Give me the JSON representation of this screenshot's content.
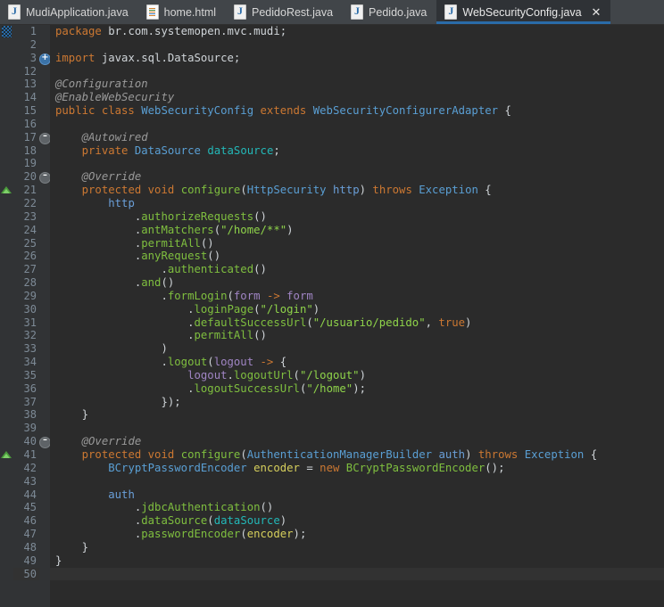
{
  "window": {
    "app": "Eclipse IDE - Java Editor",
    "background_color": "#2b2b2b",
    "accent_color": "#2a6ba8"
  },
  "tabbar": {
    "tabs": [
      {
        "label": "MudiApplication.java",
        "icon": "java-file-icon",
        "active": false,
        "closable": false
      },
      {
        "label": "home.html",
        "icon": "html-file-icon",
        "active": false,
        "closable": false
      },
      {
        "label": "PedidoRest.java",
        "icon": "java-file-icon",
        "active": false,
        "closable": false
      },
      {
        "label": "Pedido.java",
        "icon": "java-file-icon",
        "active": false,
        "closable": false
      },
      {
        "label": "WebSecurityConfig.java",
        "icon": "java-file-icon",
        "active": true,
        "closable": true,
        "close_label": "✕"
      }
    ]
  },
  "editor": {
    "file": "WebSecurityConfig.java",
    "language": "java",
    "current_line": 50,
    "line_numbers": [
      1,
      2,
      3,
      12,
      13,
      14,
      15,
      16,
      17,
      18,
      19,
      20,
      21,
      22,
      23,
      24,
      25,
      26,
      27,
      28,
      29,
      30,
      31,
      32,
      33,
      34,
      35,
      36,
      37,
      38,
      39,
      40,
      41,
      42,
      43,
      44,
      45,
      46,
      47,
      48,
      49,
      50
    ],
    "markers": {
      "change_bar_lines": [
        1
      ],
      "override_triangle_lines": [
        21,
        41
      ],
      "fold_expand_lines": [
        3
      ],
      "fold_collapse_lines": [
        17,
        20,
        40
      ]
    },
    "lines": [
      {
        "n": 1,
        "tokens": [
          [
            "kw",
            "package"
          ],
          [
            "plain",
            " br.com.systemopen.mvc.mudi;"
          ]
        ]
      },
      {
        "n": 2,
        "tokens": []
      },
      {
        "n": 3,
        "tokens": [
          [
            "kw",
            "import"
          ],
          [
            "plain",
            " javax.sql.DataSource;"
          ]
        ]
      },
      {
        "n": 12,
        "tokens": []
      },
      {
        "n": 13,
        "tokens": [
          [
            "ann",
            "@Configuration"
          ]
        ]
      },
      {
        "n": 14,
        "tokens": [
          [
            "ann",
            "@EnableWebSecurity"
          ]
        ]
      },
      {
        "n": 15,
        "tokens": [
          [
            "kw",
            "public class "
          ],
          [
            "type",
            "WebSecurityConfig"
          ],
          [
            "kw",
            " extends "
          ],
          [
            "type",
            "WebSecurityConfigurerAdapter"
          ],
          [
            "punct",
            " {"
          ]
        ]
      },
      {
        "n": 16,
        "tokens": []
      },
      {
        "n": 17,
        "tokens": [
          [
            "plain",
            "    "
          ],
          [
            "ann",
            "@Autowired"
          ]
        ]
      },
      {
        "n": 18,
        "tokens": [
          [
            "plain",
            "    "
          ],
          [
            "kw",
            "private "
          ],
          [
            "type",
            "DataSource"
          ],
          [
            "plain",
            " "
          ],
          [
            "fld",
            "dataSource"
          ],
          [
            "punct",
            ";"
          ]
        ]
      },
      {
        "n": 19,
        "tokens": []
      },
      {
        "n": 20,
        "tokens": [
          [
            "plain",
            "    "
          ],
          [
            "ann",
            "@Override"
          ]
        ]
      },
      {
        "n": 21,
        "tokens": [
          [
            "plain",
            "    "
          ],
          [
            "kw",
            "protected void "
          ],
          [
            "meth",
            "configure"
          ],
          [
            "punct",
            "("
          ],
          [
            "type",
            "HttpSecurity"
          ],
          [
            "plain",
            " "
          ],
          [
            "parm2",
            "http"
          ],
          [
            "punct",
            ") "
          ],
          [
            "kw",
            "throws "
          ],
          [
            "type",
            "Exception"
          ],
          [
            "punct",
            " {"
          ]
        ]
      },
      {
        "n": 22,
        "tokens": [
          [
            "plain",
            "        "
          ],
          [
            "parm2",
            "http"
          ]
        ]
      },
      {
        "n": 23,
        "tokens": [
          [
            "plain",
            "            ."
          ],
          [
            "meth",
            "authorizeRequests"
          ],
          [
            "punct",
            "()"
          ]
        ]
      },
      {
        "n": 24,
        "tokens": [
          [
            "plain",
            "            ."
          ],
          [
            "meth",
            "antMatchers"
          ],
          [
            "punct",
            "("
          ],
          [
            "str",
            "\"/home/**\""
          ],
          [
            "punct",
            ")"
          ]
        ]
      },
      {
        "n": 25,
        "tokens": [
          [
            "plain",
            "            ."
          ],
          [
            "meth",
            "permitAll"
          ],
          [
            "punct",
            "()"
          ]
        ]
      },
      {
        "n": 26,
        "tokens": [
          [
            "plain",
            "            ."
          ],
          [
            "meth",
            "anyRequest"
          ],
          [
            "punct",
            "()"
          ]
        ]
      },
      {
        "n": 27,
        "tokens": [
          [
            "plain",
            "                ."
          ],
          [
            "meth",
            "authenticated"
          ],
          [
            "punct",
            "()"
          ]
        ]
      },
      {
        "n": 28,
        "tokens": [
          [
            "plain",
            "            ."
          ],
          [
            "meth",
            "and"
          ],
          [
            "punct",
            "()"
          ]
        ]
      },
      {
        "n": 29,
        "tokens": [
          [
            "plain",
            "                ."
          ],
          [
            "meth",
            "formLogin"
          ],
          [
            "punct",
            "("
          ],
          [
            "param",
            "form"
          ],
          [
            "plain",
            " "
          ],
          [
            "kw",
            "-> "
          ],
          [
            "param",
            "form"
          ]
        ]
      },
      {
        "n": 30,
        "tokens": [
          [
            "plain",
            "                    ."
          ],
          [
            "meth",
            "loginPage"
          ],
          [
            "punct",
            "("
          ],
          [
            "str",
            "\"/login\""
          ],
          [
            "punct",
            ")"
          ]
        ]
      },
      {
        "n": 31,
        "tokens": [
          [
            "plain",
            "                    ."
          ],
          [
            "meth",
            "defaultSuccessUrl"
          ],
          [
            "punct",
            "("
          ],
          [
            "str",
            "\"/usuario/pedido\""
          ],
          [
            "punct",
            ", "
          ],
          [
            "kw",
            "true"
          ],
          [
            "punct",
            ")"
          ]
        ]
      },
      {
        "n": 32,
        "tokens": [
          [
            "plain",
            "                    ."
          ],
          [
            "meth",
            "permitAll"
          ],
          [
            "punct",
            "()"
          ]
        ]
      },
      {
        "n": 33,
        "tokens": [
          [
            "plain",
            "                )"
          ]
        ]
      },
      {
        "n": 34,
        "tokens": [
          [
            "plain",
            "                ."
          ],
          [
            "meth",
            "logout"
          ],
          [
            "punct",
            "("
          ],
          [
            "param",
            "logout"
          ],
          [
            "plain",
            " "
          ],
          [
            "kw",
            "-> "
          ],
          [
            "punct",
            "{"
          ]
        ]
      },
      {
        "n": 35,
        "tokens": [
          [
            "plain",
            "                    "
          ],
          [
            "param",
            "logout"
          ],
          [
            "punct",
            "."
          ],
          [
            "meth",
            "logoutUrl"
          ],
          [
            "punct",
            "("
          ],
          [
            "str",
            "\"/logout\""
          ],
          [
            "punct",
            ")"
          ]
        ]
      },
      {
        "n": 36,
        "tokens": [
          [
            "plain",
            "                    ."
          ],
          [
            "meth",
            "logoutSuccessUrl"
          ],
          [
            "punct",
            "("
          ],
          [
            "str",
            "\"/home\""
          ],
          [
            "punct",
            ");"
          ]
        ]
      },
      {
        "n": 37,
        "tokens": [
          [
            "plain",
            "                });"
          ]
        ]
      },
      {
        "n": 38,
        "tokens": [
          [
            "plain",
            "    }"
          ]
        ]
      },
      {
        "n": 39,
        "tokens": []
      },
      {
        "n": 40,
        "tokens": [
          [
            "plain",
            "    "
          ],
          [
            "ann",
            "@Override"
          ]
        ]
      },
      {
        "n": 41,
        "tokens": [
          [
            "plain",
            "    "
          ],
          [
            "kw",
            "protected void "
          ],
          [
            "meth",
            "configure"
          ],
          [
            "punct",
            "("
          ],
          [
            "type",
            "AuthenticationManagerBuilder"
          ],
          [
            "plain",
            " "
          ],
          [
            "parm2",
            "auth"
          ],
          [
            "punct",
            ") "
          ],
          [
            "kw",
            "throws "
          ],
          [
            "type",
            "Exception"
          ],
          [
            "punct",
            " {"
          ]
        ]
      },
      {
        "n": 42,
        "tokens": [
          [
            "plain",
            "        "
          ],
          [
            "type",
            "BCryptPasswordEncoder"
          ],
          [
            "plain",
            " "
          ],
          [
            "lvar",
            "encoder"
          ],
          [
            "punct",
            " = "
          ],
          [
            "kw",
            "new "
          ],
          [
            "meth",
            "BCryptPasswordEncoder"
          ],
          [
            "punct",
            "();"
          ]
        ]
      },
      {
        "n": 43,
        "tokens": []
      },
      {
        "n": 44,
        "tokens": [
          [
            "plain",
            "        "
          ],
          [
            "parm2",
            "auth"
          ]
        ]
      },
      {
        "n": 45,
        "tokens": [
          [
            "plain",
            "            ."
          ],
          [
            "meth",
            "jdbcAuthentication"
          ],
          [
            "punct",
            "()"
          ]
        ]
      },
      {
        "n": 46,
        "tokens": [
          [
            "plain",
            "            ."
          ],
          [
            "meth",
            "dataSource"
          ],
          [
            "punct",
            "("
          ],
          [
            "fld",
            "dataSource"
          ],
          [
            "punct",
            ")"
          ]
        ]
      },
      {
        "n": 47,
        "tokens": [
          [
            "plain",
            "            ."
          ],
          [
            "meth",
            "passwordEncoder"
          ],
          [
            "punct",
            "("
          ],
          [
            "lvar",
            "encoder"
          ],
          [
            "punct",
            ");"
          ]
        ]
      },
      {
        "n": 48,
        "tokens": [
          [
            "plain",
            "    }"
          ]
        ]
      },
      {
        "n": 49,
        "tokens": [
          [
            "plain",
            "}"
          ]
        ]
      },
      {
        "n": 50,
        "tokens": []
      }
    ]
  },
  "syntax_colors": {
    "keyword": "#cc7832",
    "type": "#5a9fd4",
    "method": "#7fbf3f",
    "string": "#8fd44a",
    "annotation": "#9a9a9a",
    "field": "#23b8b8",
    "lambda_param": "#a085c4",
    "method_param": "#6a9fd8",
    "local_var": "#d6cf5c",
    "plain": "#cfd4d8",
    "line_number": "#7d8a96"
  }
}
